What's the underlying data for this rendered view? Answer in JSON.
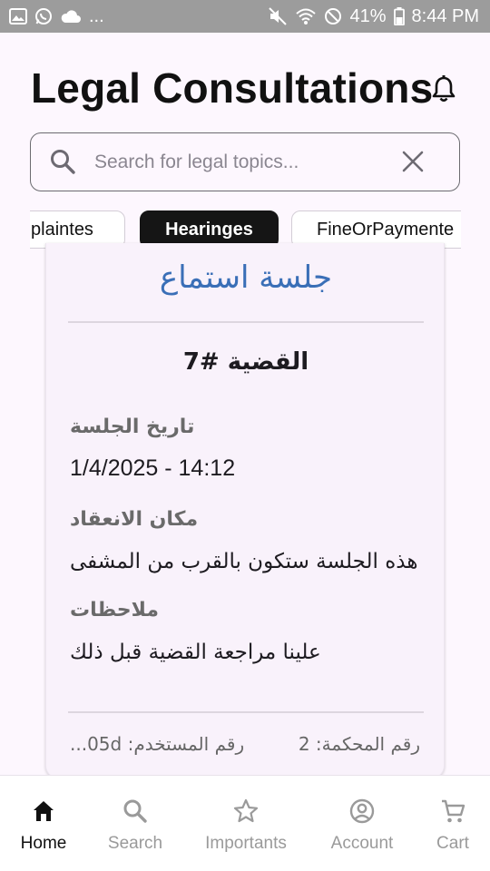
{
  "status_bar": {
    "left_icons": [
      "image-icon",
      "whatsapp-icon",
      "cloud-icon"
    ],
    "more": "...",
    "battery_text": "41%",
    "time": "8:44 PM"
  },
  "header": {
    "title": "Legal Consultations"
  },
  "search": {
    "placeholder": "Search for legal topics...",
    "value": ""
  },
  "chips": [
    {
      "label": "plaintes",
      "active": false
    },
    {
      "label": "Hearinges",
      "active": true
    },
    {
      "label": "FineOrPaymente",
      "active": false
    }
  ],
  "card": {
    "title": "جلسة استماع",
    "case_title": "القضية #7",
    "date_label": "تاريخ الجلسة",
    "date_value": "1/4/2025 - 14:12",
    "location_label": "مكان الانعقاد",
    "location_value": "هذه الجلسة ستكون بالقرب من المشفى",
    "notes_label": "ملاحظات",
    "notes_value": "علينا مراجعة القضية قبل ذلك",
    "court_number": "رقم المحكمة: 2",
    "user_number": "رقم المستخدم: 05d..."
  },
  "bottom_nav": [
    {
      "label": "Home",
      "icon": "home-icon",
      "active": true
    },
    {
      "label": "Search",
      "icon": "search-icon",
      "active": false
    },
    {
      "label": "Importants",
      "icon": "star-icon",
      "active": false
    },
    {
      "label": "Account",
      "icon": "account-icon",
      "active": false
    },
    {
      "label": "Cart",
      "icon": "cart-icon",
      "active": false
    }
  ],
  "colors": {
    "accent_blue": "#3a6fb7",
    "active_chip": "#151515",
    "background": "#fdf7fe",
    "status_bar": "#9c9c9c"
  }
}
